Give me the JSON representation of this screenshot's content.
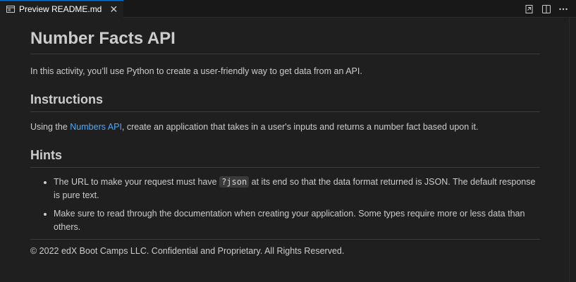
{
  "tab": {
    "label": "Preview README.md",
    "icon": "preview-icon",
    "close_glyph": "✕"
  },
  "editor_actions": [
    {
      "name": "open-source-icon"
    },
    {
      "name": "split-editor-icon"
    },
    {
      "name": "more-actions-icon"
    }
  ],
  "doc": {
    "title": "Number Facts API",
    "intro": "In this activity, you’ll use Python to create a user-friendly way to get data from an API.",
    "instructions": {
      "heading": "Instructions",
      "before": "Using the ",
      "link": "Numbers API",
      "after": ", create an application that takes in a user's inputs and returns a number fact based upon it."
    },
    "hints": {
      "heading": "Hints",
      "items": [
        {
          "before": "The URL to make your request must have ",
          "code": "?json",
          "after": " at its end so that the data format returned is JSON. The default response is pure text."
        },
        {
          "text": "Make sure to read through the documentation when creating your application. Some types require more or less data than others."
        }
      ]
    },
    "footer": "© 2022 edX Boot Camps LLC. Confidential and Proprietary. All Rights Reserved."
  },
  "colors": {
    "background": "#1f1f1f",
    "text": "#cccccc",
    "link": "#4daafc",
    "tab_accent": "#0078d4"
  }
}
